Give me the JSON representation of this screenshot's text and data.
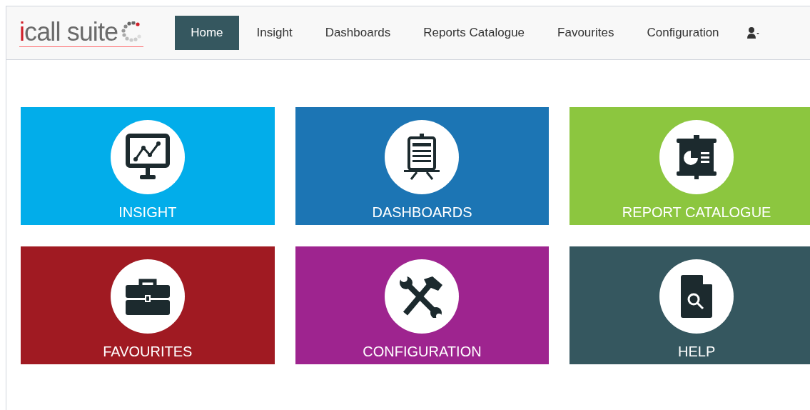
{
  "logo": "icall suite",
  "nav": [
    {
      "label": "Home",
      "selected": true
    },
    {
      "label": "Insight",
      "selected": false
    },
    {
      "label": "Dashboards",
      "selected": false
    },
    {
      "label": "Reports Catalogue",
      "selected": false
    },
    {
      "label": "Favourites",
      "selected": false
    },
    {
      "label": "Configuration",
      "selected": false
    }
  ],
  "tiles": [
    {
      "label": "INSIGHT",
      "kind": "insight",
      "color": "#02adea"
    },
    {
      "label": "DASHBOARDS",
      "kind": "dashboards",
      "color": "#1c75b4"
    },
    {
      "label": "REPORT CATALOGUE",
      "kind": "reports",
      "color": "#8cc63f"
    },
    {
      "label": "FAVOURITES",
      "kind": "favourites",
      "color": "#a01a22"
    },
    {
      "label": "CONFIGURATION",
      "kind": "configuration",
      "color": "#9e248f"
    },
    {
      "label": "HELP",
      "kind": "help",
      "color": "#35575f"
    }
  ]
}
